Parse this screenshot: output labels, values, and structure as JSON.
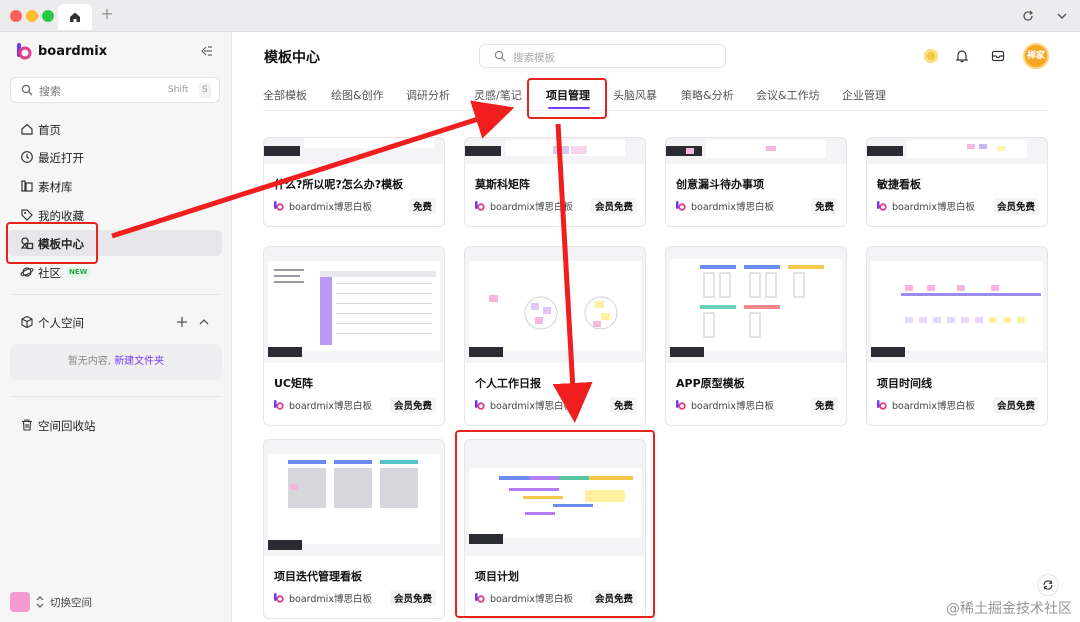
{
  "app": {
    "brand": "boardmix",
    "accent": "#7a3cf0"
  },
  "sidebar": {
    "search_label": "搜索",
    "search_kbd1": "Shift",
    "search_kbd2": "S",
    "items": [
      {
        "label": "首页",
        "icon": "home-icon"
      },
      {
        "label": "最近打开",
        "icon": "clock-icon"
      },
      {
        "label": "素材库",
        "icon": "library-icon"
      },
      {
        "label": "我的收藏",
        "icon": "tag-icon"
      },
      {
        "label": "模板中心",
        "icon": "template-icon"
      },
      {
        "label": "社区",
        "icon": "planet-icon",
        "badge": "NEW"
      }
    ],
    "personal_space": "个人空间",
    "empty_text": "暂无内容,",
    "new_folder": "新建文件夹",
    "trash": "空间回收站",
    "switch_space": "切换空间"
  },
  "header": {
    "title": "模板中心",
    "search_placeholder": "搜索模板",
    "avatar_text": "禅家"
  },
  "tabs": [
    "全部模板",
    "绘图&创作",
    "调研分析",
    "灵感/笔记",
    "项目管理",
    "头脑风暴",
    "策略&分析",
    "会议&工作坊",
    "企业管理"
  ],
  "cards": [
    {
      "name": "什么?所以呢?怎么办?模板",
      "owner": "boardmix博思白板",
      "price": "免费"
    },
    {
      "name": "莫斯科矩阵",
      "owner": "boardmix博思白板",
      "price": "会员免费"
    },
    {
      "name": "创意漏斗待办事项",
      "owner": "boardmix博思白板",
      "price": "免费"
    },
    {
      "name": "敏捷看板",
      "owner": "boardmix博思白板",
      "price": "会员免费"
    },
    {
      "name": "UC矩阵",
      "owner": "boardmix博思白板",
      "price": "会员免费"
    },
    {
      "name": "个人工作日报",
      "owner": "boardmix博思白板",
      "price": "免费"
    },
    {
      "name": "APP原型模板",
      "owner": "boardmix博思白板",
      "price": "免费"
    },
    {
      "name": "项目时间线",
      "owner": "boardmix博思白板",
      "price": "会员免费"
    },
    {
      "name": "项目迭代管理看板",
      "owner": "boardmix博思白板",
      "price": "会员免费"
    },
    {
      "name": "项目计划",
      "owner": "boardmix博思白板",
      "price": "会员免费"
    }
  ],
  "watermark": "@稀土掘金技术社区"
}
